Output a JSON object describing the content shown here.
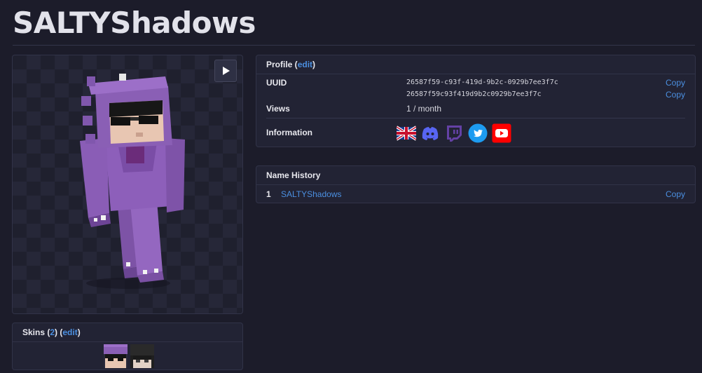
{
  "page": {
    "title": "SALTYShadows"
  },
  "viewer": {
    "play_label": "play"
  },
  "profile": {
    "header_label": "Profile",
    "edit_label": "edit",
    "uuid_label": "UUID",
    "uuid_dashed": "26587f59-c93f-419d-9b2c-0929b7ee3f7c",
    "uuid_plain": "26587f59c93f419d9b2c0929b7ee3f7c",
    "copy_label": "Copy",
    "views_label": "Views",
    "views_value": "1 / month",
    "information_label": "Information",
    "socials": [
      "uk-flag-icon",
      "discord-icon",
      "twitch-icon",
      "twitter-icon",
      "youtube-icon"
    ]
  },
  "name_history": {
    "header_label": "Name History",
    "entries": [
      {
        "index": "1",
        "name": "SALTYShadows"
      }
    ],
    "copy_label": "Copy"
  },
  "skins": {
    "header_label": "Skins",
    "count": "2",
    "edit_label": "edit"
  },
  "colors": {
    "background": "#1c1c2a",
    "card": "#222334",
    "link": "#4b8fe0",
    "skin_purple": "#8a5fb5"
  }
}
